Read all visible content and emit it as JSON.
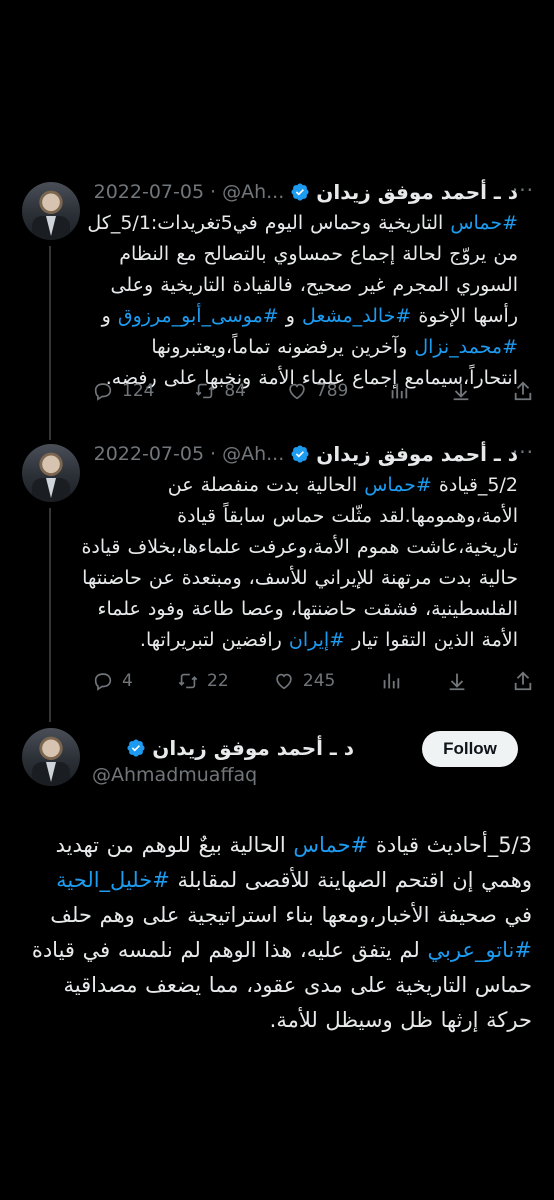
{
  "tweets": [
    {
      "name": "د ـ أحمد موفق زيدان",
      "handle": "@Ah...",
      "dot": "·",
      "date": "2022-07-05",
      "more": "···",
      "text_parts": [
        {
          "t": "#حماس",
          "tag": true
        },
        {
          "t": " التاريخية وحماس اليوم في5تغريدات:",
          "tag": false
        },
        {
          "t": "5/1_كل من يروّج لحالة إجماع حمساوي بالتصالح مع النظام السوري المجرم غير صحيح، فالقيادة التاريخية وعلى رأسها الإخوة ",
          "tag": false
        },
        {
          "t": "#خالد_مشعل",
          "tag": true
        },
        {
          "t": " و ",
          "tag": false
        },
        {
          "t": "#موسى_أبو_مرزوق",
          "tag": true
        },
        {
          "t": " و ",
          "tag": false
        },
        {
          "t": "#محمد_نزال",
          "tag": true
        },
        {
          "t": " وآخرين يرفضونه تماماً،ويعتبرونها انتحاراً،سيمامع إجماع علماء الأمة ونخبها على رفضه.",
          "tag": false
        }
      ],
      "replies": "124",
      "retweets": "84",
      "likes": "789"
    },
    {
      "name": "د ـ أحمد موفق زيدان",
      "handle": "@Ah...",
      "dot": "·",
      "date": "2022-07-05",
      "more": "···",
      "text_parts": [
        {
          "t": "5/2_قيادة ",
          "tag": false
        },
        {
          "t": "#حماس",
          "tag": true
        },
        {
          "t": " الحالية بدت منفصلة عن الأمة،وهمومها.لقد مثّلت حماس سابقاً قيادة تاريخية،عاشت هموم الأمة،وعرفت علماءها،بخلاف قيادة حالية بدت مرتهنة للإيراني للأسف، ومبتعدة عن حاضنتها الفلسطينية، فشقت حاضنتها، وعصا طاعة وفود علماء الأمة الذين التقوا تيار ",
          "tag": false
        },
        {
          "t": "#إيران",
          "tag": true
        },
        {
          "t": " رافضين لتبريراتها.",
          "tag": false
        }
      ],
      "replies": "4",
      "retweets": "22",
      "likes": "245"
    },
    {
      "name": "د ـ أحمد موفق زيدان",
      "handle": "@Ahmadmuaffaq",
      "follow_label": "Follow",
      "text_parts": [
        {
          "t": "5/3_أحاديث قيادة ",
          "tag": false
        },
        {
          "t": "#حماس",
          "tag": true
        },
        {
          "t": " الحالية بيعٌ للوهم من تهديد وهمي إن اقتحم الصهاينة للأقصى لمقابلة ",
          "tag": false
        },
        {
          "t": "#خليل_الحية",
          "tag": true
        },
        {
          "t": " في صحيفة الأخبار،ومعها بناء استراتيجية على وهم حلف ",
          "tag": false
        },
        {
          "t": "#ناتو_عربي",
          "tag": true
        },
        {
          "t": "  لم يتفق عليه، هذا الوهم لم نلمسه في قيادة حماس التاريخية على مدى عقود، مما يضعف مصداقية حركة إرثها ظل وسيظل للأمة.",
          "tag": false
        }
      ]
    }
  ],
  "colors": {
    "background": "#000000",
    "text": "#e7e9ea",
    "muted": "#71767b",
    "link": "#1d9bf0",
    "verified": "#1d9bf0"
  },
  "icons": [
    "reply-icon",
    "retweet-icon",
    "like-icon",
    "views-icon",
    "bookmark-icon",
    "share-icon",
    "verified-badge-icon"
  ]
}
